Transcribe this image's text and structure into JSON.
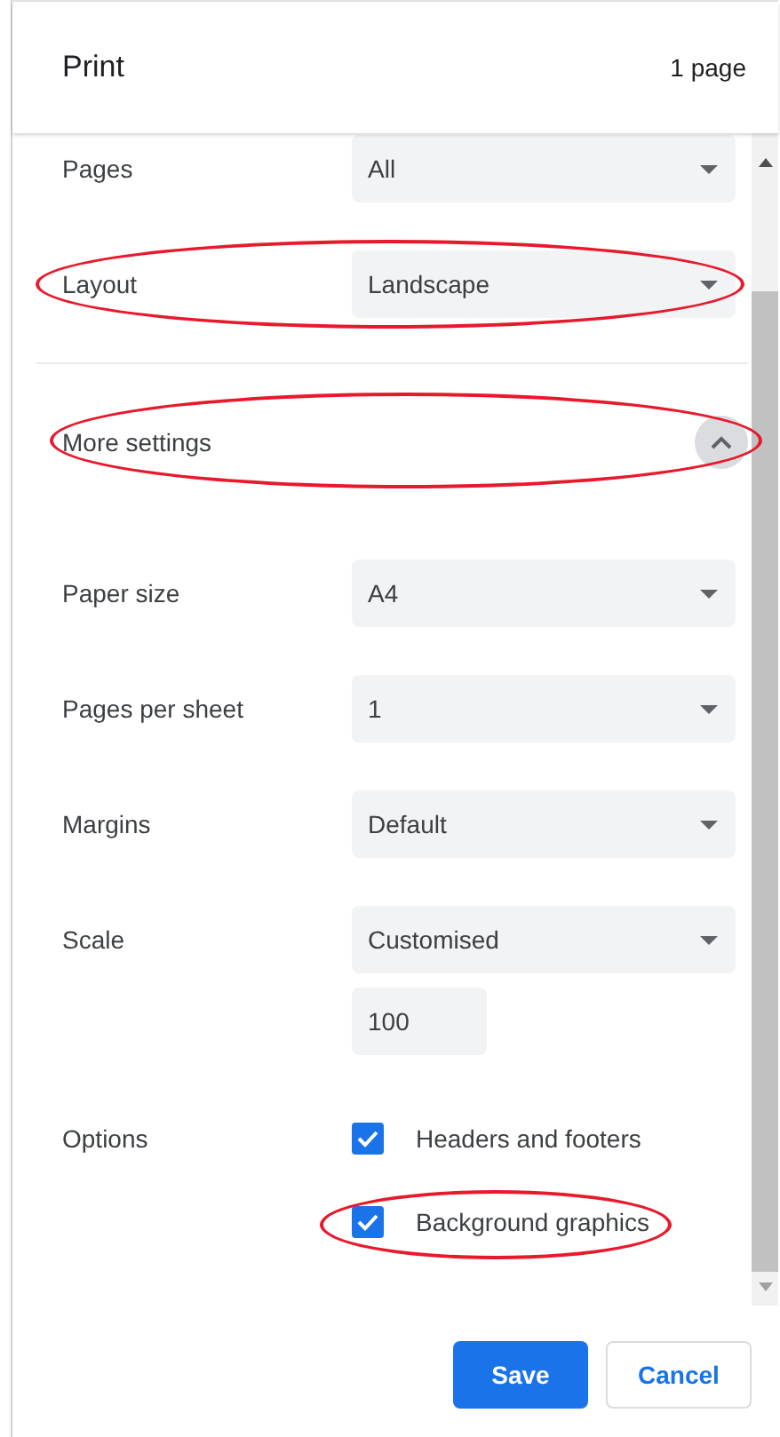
{
  "dialog": {
    "title": "Print",
    "page_count": "1 page"
  },
  "settings": [
    {
      "kind": "select",
      "label": "Pages",
      "value": "All",
      "highlighted": false
    },
    {
      "kind": "select",
      "label": "Layout",
      "value": "Landscape",
      "highlighted": true
    },
    {
      "kind": "section-toggle",
      "label": "More settings",
      "expanded": true,
      "highlighted": true
    },
    {
      "kind": "select",
      "label": "Paper size",
      "value": "A4",
      "highlighted": false
    },
    {
      "kind": "select",
      "label": "Pages per sheet",
      "value": "1",
      "highlighted": false
    },
    {
      "kind": "select",
      "label": "Margins",
      "value": "Default",
      "highlighted": false
    },
    {
      "kind": "select",
      "label": "Scale",
      "value": "Customised",
      "field_value": "100",
      "highlighted": false
    },
    {
      "kind": "checkboxes",
      "label": "Options",
      "options": [
        {
          "label": "Headers and footers",
          "checked": true,
          "highlighted": false
        },
        {
          "label": "Background graphics",
          "checked": true,
          "highlighted": true
        }
      ]
    }
  ],
  "buttons": [
    {
      "label": "Save",
      "kind": "primary"
    },
    {
      "label": "Cancel",
      "kind": "secondary"
    }
  ]
}
